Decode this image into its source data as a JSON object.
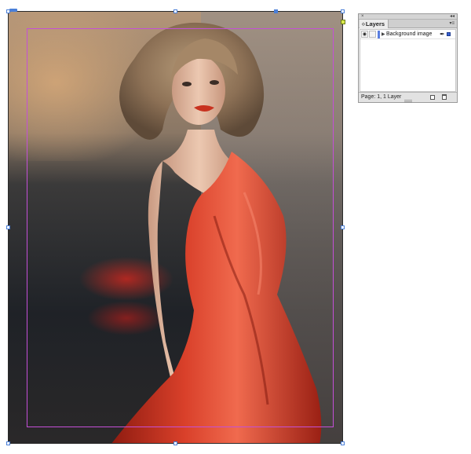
{
  "document": {
    "image_subject": "woman-in-red-dress-photo"
  },
  "layers_panel": {
    "close_glyph": "×",
    "collapse_glyph": "◂◂",
    "tab_arrows": "◇",
    "tab_label": "Layers",
    "menu_glyph": "▾≡",
    "layers": [
      {
        "name": "Background image",
        "visible_glyph": "◉",
        "expand_glyph": "▶",
        "pen_glyph": "✒",
        "color": "#5a7ee0"
      }
    ],
    "footer_status": "Page: 1, 1 Layer"
  },
  "colors": {
    "selection": "#4a7fd8",
    "margin_guide": "#c44fd8",
    "dress": "#c8321f",
    "layer_color": "#5a7ee0"
  },
  "icons": [
    "eye-icon",
    "lock-icon",
    "expand-triangle-icon",
    "pen-icon",
    "new-layer-icon",
    "trash-icon",
    "close-icon",
    "collapse-icon",
    "panel-menu-icon"
  ]
}
